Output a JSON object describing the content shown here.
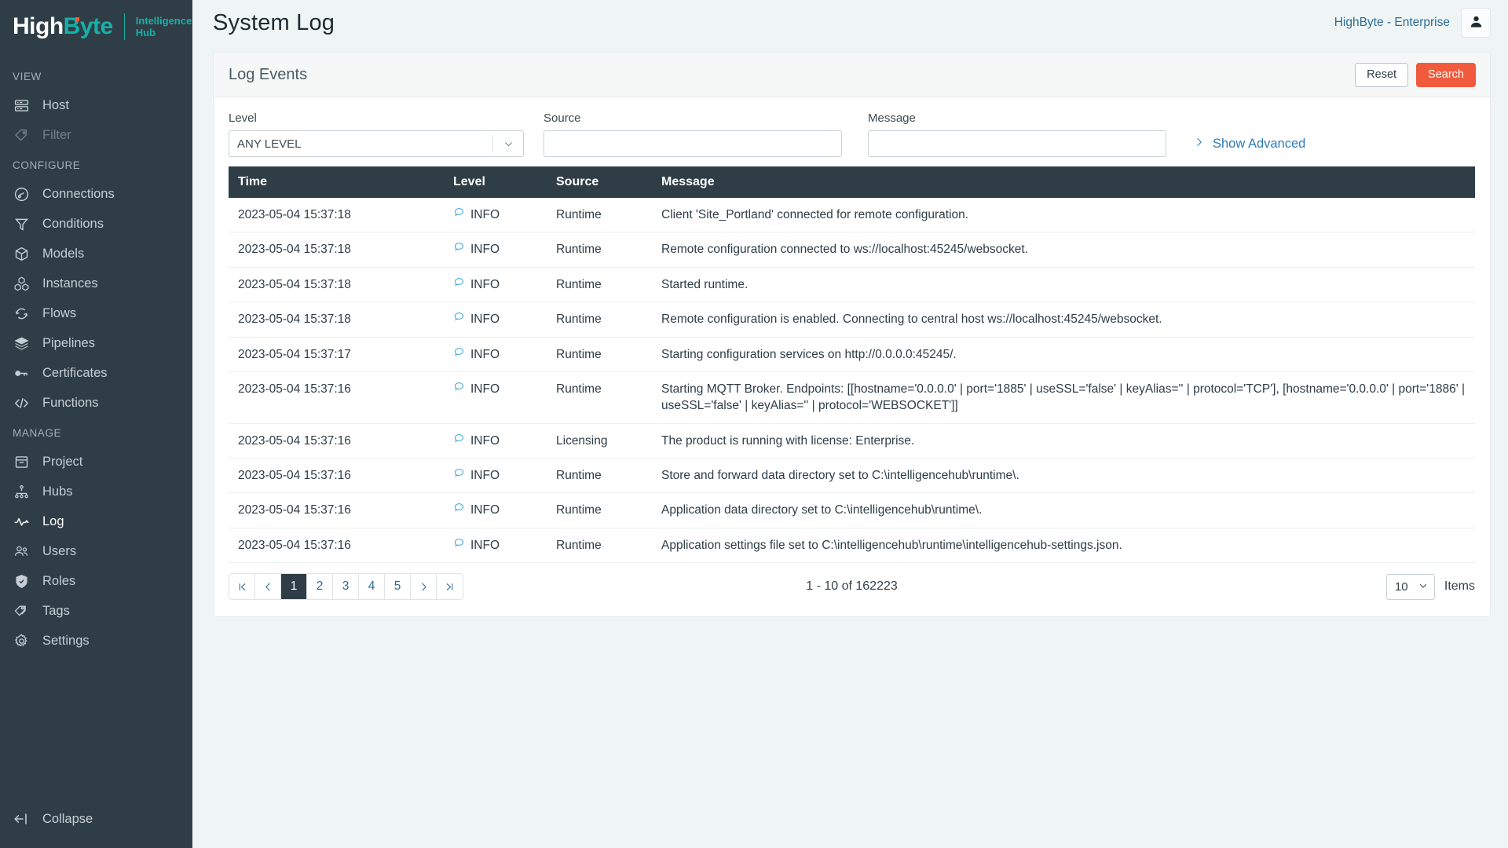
{
  "brand": {
    "name_part1": "High",
    "name_part2": "Byte",
    "subtitle_line1": "Intelligence",
    "subtitle_line2": "Hub",
    "accent_teal": "#16b0a8",
    "accent_orange": "#f15a3c"
  },
  "sidebar": {
    "sections": [
      {
        "label": "VIEW",
        "items": [
          {
            "label": "Host",
            "icon": "server-icon",
            "state": "normal"
          },
          {
            "label": "Filter",
            "icon": "tag-icon",
            "state": "disabled"
          }
        ]
      },
      {
        "label": "CONFIGURE",
        "items": [
          {
            "label": "Connections",
            "icon": "plug-icon",
            "state": "normal"
          },
          {
            "label": "Conditions",
            "icon": "funnel-icon",
            "state": "normal"
          },
          {
            "label": "Models",
            "icon": "box-icon",
            "state": "normal"
          },
          {
            "label": "Instances",
            "icon": "boxes-icon",
            "state": "normal"
          },
          {
            "label": "Flows",
            "icon": "refresh-icon",
            "state": "normal"
          },
          {
            "label": "Pipelines",
            "icon": "layers-icon",
            "state": "normal"
          },
          {
            "label": "Certificates",
            "icon": "key-icon",
            "state": "normal"
          },
          {
            "label": "Functions",
            "icon": "code-icon",
            "state": "normal"
          }
        ]
      },
      {
        "label": "MANAGE",
        "items": [
          {
            "label": "Project",
            "icon": "archive-icon",
            "state": "normal"
          },
          {
            "label": "Hubs",
            "icon": "sitemap-icon",
            "state": "normal"
          },
          {
            "label": "Log",
            "icon": "pulse-icon",
            "state": "active"
          },
          {
            "label": "Users",
            "icon": "users-icon",
            "state": "normal"
          },
          {
            "label": "Roles",
            "icon": "shield-icon",
            "state": "normal"
          },
          {
            "label": "Tags",
            "icon": "tags-icon",
            "state": "normal"
          },
          {
            "label": "Settings",
            "icon": "gear-icon",
            "state": "normal"
          }
        ]
      }
    ],
    "collapse_label": "Collapse",
    "collapse_icon": "collapse-left-icon"
  },
  "topbar": {
    "page_title": "System Log",
    "tenant": "HighByte - Enterprise",
    "avatar_icon": "user-icon"
  },
  "card": {
    "title": "Log Events",
    "reset_label": "Reset",
    "search_label": "Search"
  },
  "filters": {
    "level_label": "Level",
    "level_value": "ANY LEVEL",
    "source_label": "Source",
    "source_value": "",
    "source_placeholder": "",
    "message_label": "Message",
    "message_value": "",
    "message_placeholder": "",
    "show_advanced_label": "Show Advanced"
  },
  "table": {
    "columns": [
      "Time",
      "Level",
      "Source",
      "Message"
    ],
    "rows": [
      {
        "time": "2023-05-04 15:37:18",
        "level": "INFO",
        "source": "Runtime",
        "message": "Client 'Site_Portland' connected for remote configuration."
      },
      {
        "time": "2023-05-04 15:37:18",
        "level": "INFO",
        "source": "Runtime",
        "message": "Remote configuration connected to ws://localhost:45245/websocket."
      },
      {
        "time": "2023-05-04 15:37:18",
        "level": "INFO",
        "source": "Runtime",
        "message": "Started runtime."
      },
      {
        "time": "2023-05-04 15:37:18",
        "level": "INFO",
        "source": "Runtime",
        "message": "Remote configuration is enabled. Connecting to central host ws://localhost:45245/websocket."
      },
      {
        "time": "2023-05-04 15:37:17",
        "level": "INFO",
        "source": "Runtime",
        "message": "Starting configuration services on http://0.0.0.0:45245/."
      },
      {
        "time": "2023-05-04 15:37:16",
        "level": "INFO",
        "source": "Runtime",
        "message": "Starting MQTT Broker. Endpoints: [[hostname='0.0.0.0' | port='1885' | useSSL='false' | keyAlias='' | protocol='TCP'], [hostname='0.0.0.0' | port='1886' | useSSL='false' | keyAlias='' | protocol='WEBSOCKET']]"
      },
      {
        "time": "2023-05-04 15:37:16",
        "level": "INFO",
        "source": "Licensing",
        "message": "The product is running with license: Enterprise."
      },
      {
        "time": "2023-05-04 15:37:16",
        "level": "INFO",
        "source": "Runtime",
        "message": "Store and forward data directory set to C:\\intelligencehub\\runtime\\."
      },
      {
        "time": "2023-05-04 15:37:16",
        "level": "INFO",
        "source": "Runtime",
        "message": "Application data directory set to C:\\intelligencehub\\runtime\\."
      },
      {
        "time": "2023-05-04 15:37:16",
        "level": "INFO",
        "source": "Runtime",
        "message": "Application settings file set to C:\\intelligencehub\\runtime\\intelligencehub-settings.json."
      }
    ]
  },
  "pager": {
    "first_icon": "first-page-icon",
    "prev_icon": "prev-page-icon",
    "pages": [
      "1",
      "2",
      "3",
      "4",
      "5"
    ],
    "current_page": "1",
    "next_icon": "next-page-icon",
    "last_icon": "last-page-icon",
    "count_text": "1 - 10 of 162223",
    "items_per_page": "10",
    "items_label": "Items"
  }
}
